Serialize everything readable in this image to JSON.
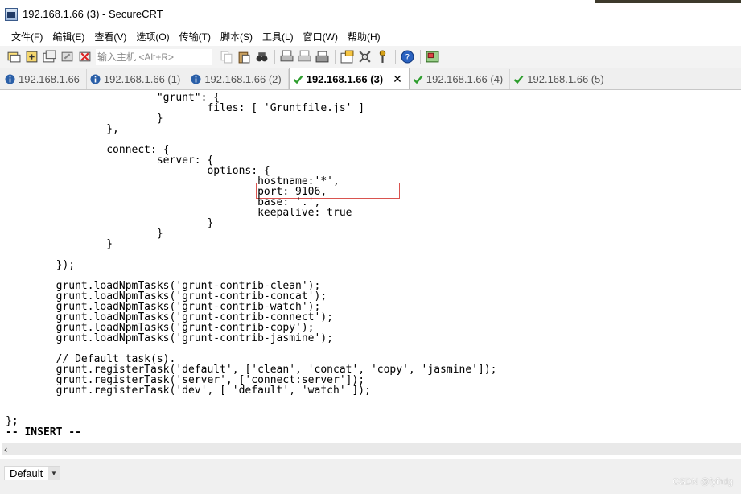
{
  "window": {
    "title": "192.168.1.66 (3) - SecureCRT"
  },
  "menu": [
    "文件(F)",
    "编辑(E)",
    "查看(V)",
    "选项(O)",
    "传输(T)",
    "脚本(S)",
    "工具(L)",
    "窗口(W)",
    "帮助(H)"
  ],
  "toolbar": {
    "host_placeholder": "输入主机 <Alt+R>"
  },
  "tabs": [
    {
      "label": "192.168.1.66",
      "icon": "info-icon"
    },
    {
      "label": "192.168.1.66 (1)",
      "icon": "info-icon"
    },
    {
      "label": "192.168.1.66 (2)",
      "icon": "info-icon"
    },
    {
      "label": "192.168.1.66 (3)",
      "icon": "check-icon",
      "active": true
    },
    {
      "label": "192.168.1.66 (4)",
      "icon": "check-icon"
    },
    {
      "label": "192.168.1.66 (5)",
      "icon": "check-icon"
    }
  ],
  "terminal": {
    "lines": [
      "                        \"grunt\": {",
      "                                files: [ 'Gruntfile.js' ]",
      "                        }",
      "                },",
      "",
      "                connect: {",
      "                        server: {",
      "                                options: {",
      "                                        hostname:'*',",
      "                                        port: 9106,",
      "                                        base: '.',",
      "                                        keepalive: true",
      "                                }",
      "                        }",
      "                }",
      "",
      "        });",
      "",
      "        grunt.loadNpmTasks('grunt-contrib-clean');",
      "        grunt.loadNpmTasks('grunt-contrib-concat');",
      "        grunt.loadNpmTasks('grunt-contrib-watch');",
      "        grunt.loadNpmTasks('grunt-contrib-connect');",
      "        grunt.loadNpmTasks('grunt-contrib-copy');",
      "        grunt.loadNpmTasks('grunt-contrib-jasmine');",
      "",
      "        // Default task(s).",
      "        grunt.registerTask('default', ['clean', 'concat', 'copy', 'jasmine']);",
      "        grunt.registerTask('server', ['connect:server']);",
      "        grunt.registerTask('dev', [ 'default', 'watch' ]);",
      "",
      "",
      "",
      "};",
      "-- INSERT --"
    ]
  },
  "status": {
    "session": "Default",
    "watermark": "CSDN @fyihdg"
  },
  "colors": {
    "highlight_box": "#d9534f",
    "check": "#2e9e2e",
    "info": "#2a5fa8"
  }
}
